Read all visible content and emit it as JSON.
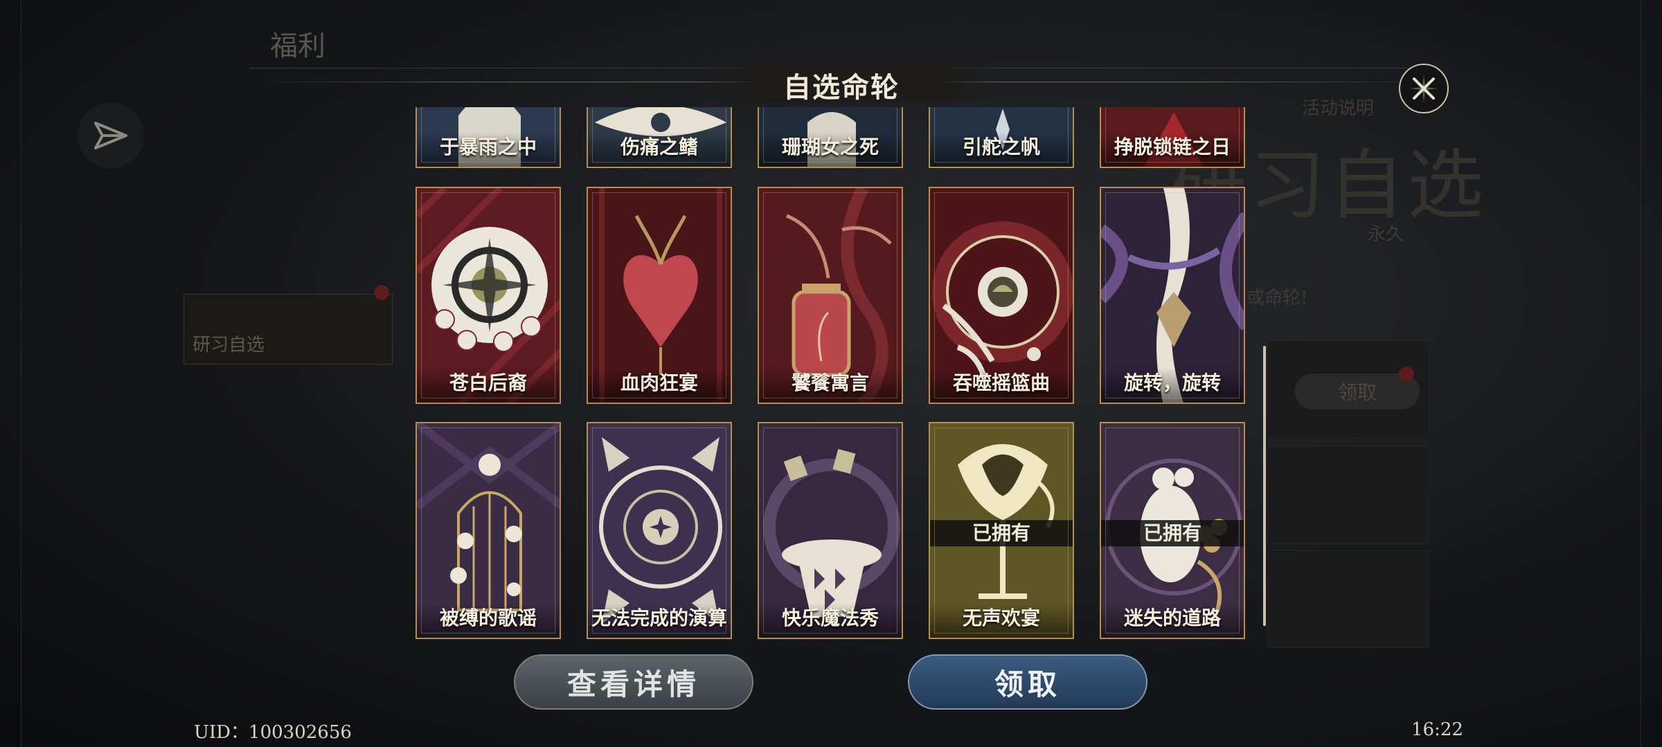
{
  "background": {
    "section_title": "福利",
    "sidebar_items": [
      "",
      "",
      "研习自选",
      "",
      "",
      ""
    ],
    "big_heading": "研习自选",
    "duration": "永久",
    "hint_text": "或命轮!",
    "claim_label": "领取",
    "event_info": "活动说明"
  },
  "modal": {
    "title": "自选命轮",
    "row_partial": [
      {
        "name": "于暴雨之中"
      },
      {
        "name": "伤痛之鳍"
      },
      {
        "name": "珊瑚女之死"
      },
      {
        "name": "引舵之帆"
      },
      {
        "name": "挣脱锁链之日"
      }
    ],
    "row_middle": [
      {
        "name": "苍白后裔"
      },
      {
        "name": "血肉狂宴"
      },
      {
        "name": "饕餮寓言"
      },
      {
        "name": "吞噬摇篮曲"
      },
      {
        "name": "旋转，旋转"
      }
    ],
    "row_bottom": [
      {
        "name": "被缚的歌谣",
        "owned": ""
      },
      {
        "name": "无法完成的演算",
        "owned": ""
      },
      {
        "name": "快乐魔法秀",
        "owned": ""
      },
      {
        "name": "无声欢宴",
        "owned": "已拥有"
      },
      {
        "name": "迷失的道路",
        "owned": "已拥有"
      }
    ],
    "view_details_label": "查看详情",
    "claim_label": "领取"
  },
  "footer": {
    "uid": "UID：100302656",
    "time": "16:22"
  },
  "colors": {
    "card_border": "#b78f4c",
    "accent_red": "#8a1f22",
    "accent_purple": "#4b3a5c",
    "accent_gold": "#9a8a3c"
  }
}
